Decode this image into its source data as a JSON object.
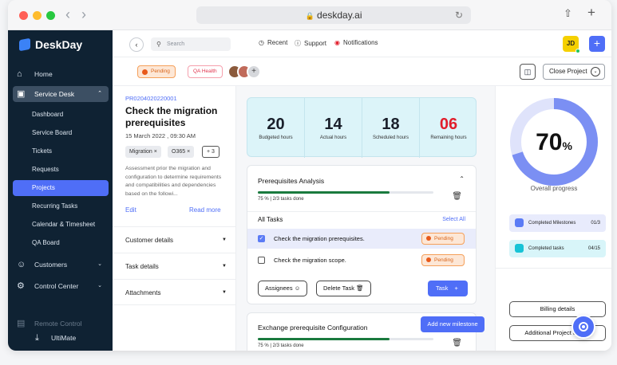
{
  "browser": {
    "url": "deskday.ai",
    "back_icon": "chevron-left-icon",
    "forward_icon": "chevron-right-icon",
    "reload_icon": "reload-icon",
    "share_icon": "share-icon",
    "newtab_icon": "plus-icon"
  },
  "app": {
    "name": "DeskDay"
  },
  "sidebar": {
    "items": [
      {
        "label": "Home",
        "icon": "home-icon"
      },
      {
        "label": "Service Desk",
        "icon": "ticket-icon"
      },
      {
        "label": "Dashboard"
      },
      {
        "label": "Service Board"
      },
      {
        "label": "Tickets"
      },
      {
        "label": "Requests"
      },
      {
        "label": "Projects"
      },
      {
        "label": "Recurring Tasks"
      },
      {
        "label": "Calendar & Timesheet"
      },
      {
        "label": "QA Board"
      },
      {
        "label": "Customers",
        "icon": "customers-icon"
      },
      {
        "label": "Control Center",
        "icon": "gear-icon"
      },
      {
        "label": "Remote Control",
        "icon": "monitor-icon"
      },
      {
        "label": "UltiMate",
        "icon": "download-icon"
      }
    ]
  },
  "topbar": {
    "search_placeholder": "Search",
    "recent": "Recent",
    "support": "Support",
    "notifications": "Notifications",
    "user_initials": "JD"
  },
  "subbar": {
    "status": "Pending",
    "tag": "QA Health",
    "more_avatars": "+",
    "close_project": "Close Project"
  },
  "project": {
    "id": "PR0204020220001",
    "title": "Check the migration prerequisites",
    "date": "15 March 2022 , 09:30 AM",
    "tags": [
      "Migration",
      "O365"
    ],
    "tags_more": "+ 3",
    "description": "Assessment prior the migration and configuration to determine requirements and compatibilities and dependencies based on the followi...",
    "edit": "Edit",
    "read_more": "Read more",
    "sections": [
      "Customer details",
      "Task details",
      "Attachments"
    ]
  },
  "stats": [
    {
      "value": "20",
      "label": "Budgeted hours"
    },
    {
      "value": "14",
      "label": "Actual hours"
    },
    {
      "value": "18",
      "label": "Scheduled hours"
    },
    {
      "value": "06",
      "label": "Remaining hours"
    }
  ],
  "milestone1": {
    "title": "Prerequisites Analysis",
    "progress_text": "75 % | 2/3 tasks done",
    "progress": 0.75,
    "all_tasks": "All Tasks",
    "select_all": "Select All",
    "tasks": [
      {
        "label": "Check the migration prerequisites.",
        "status": "Pending",
        "checked": true
      },
      {
        "label": "Check the migration scope.",
        "status": "Pending",
        "checked": false
      }
    ],
    "assignees": "Assignees",
    "delete_task": "Delete Task",
    "task_btn": "Task"
  },
  "milestone2": {
    "title": "Exchange prerequisite Configuration",
    "progress_text": "75 % | 2/3 tasks done",
    "progress": 0.75,
    "add_new": "Add new milestone"
  },
  "overall": {
    "percent": "70",
    "percent_sign": "%",
    "progress": 0.7,
    "label": "Overall progress",
    "completed_milestones": "Completed Milestones",
    "completed_milestones_value": "01/3",
    "completed_tasks": "Completed tasks",
    "completed_tasks_value": "04/15",
    "billing": "Billing details",
    "additional": "Additional Project details"
  },
  "colors": {
    "accent": "#4f6ef7",
    "sidebar": "#0f2233",
    "pending": "#e8591a",
    "red": "#e11d2b",
    "donut_light": "#dfe3fb"
  }
}
